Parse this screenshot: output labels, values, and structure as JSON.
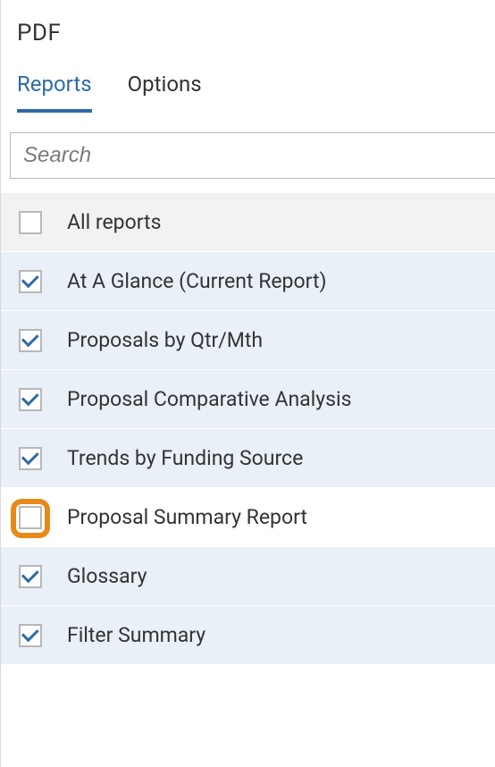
{
  "title": "PDF",
  "tabs": {
    "reports": "Reports",
    "options": "Options"
  },
  "search": {
    "placeholder": "Search",
    "value": ""
  },
  "rows": {
    "all": "All reports",
    "r1": "At A Glance (Current Report)",
    "r2": "Proposals by Qtr/Mth",
    "r3": "Proposal Comparative Analysis",
    "r4": "Trends by Funding Source",
    "r5": "Proposal Summary Report",
    "r6": "Glossary",
    "r7": "Filter Summary"
  }
}
